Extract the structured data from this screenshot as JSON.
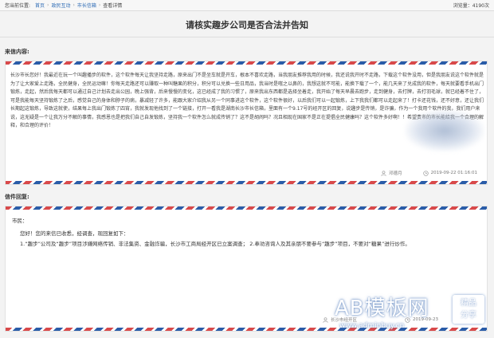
{
  "breadcrumb": {
    "label": "您当前位置:",
    "items": [
      "首页",
      "政民互动",
      "市长信箱"
    ],
    "current": "查看详情",
    "views": "浏览量：4190次"
  },
  "page_title": "请核实趣步公司是否合法并告知",
  "letter": {
    "section_label": "来信内容:",
    "body": "长沙市长您好！我最近在玩一个叫趣播步的软件，这个软件每天让我坚持走路，原来出门不是坐车就是开车，根本不喜欢走路，当我朋友推荐我用的时候，我还说我开时不走路，下载这个软件没用，但是我朋友说这个软件就是为了让大家爱上走路，全民健身，全民运动嘛！你每天走路还可以赚取一种叫糖果的积分，积分可以兑换一些日用品，我当时是嗤之以鼻的，我想这就不可能，能换下载了一个，能几天来了兑成我的软件，每天就要看手机出门锻炼，走起，然后我每天都可以通过自己计划去走出公园，晚上强背，后来慢慢的变化，这已经成了我的习惯了，原来我出东西都是选择坐着走，我开始了每天早晨去跑步，走到健身，去打牌，去打羽毛球，就已经着不住了，可是我能每天坚持锻炼了之后，感觉自己的身体和脖子的病，暴减轻了许多，能跟大家介绍我从另一个同事进这个软件，这个软件很好，以后我们可以一起锻炼，上下我我们都可以走起来了！打卡还花钱，还不好意，还让我们长期起这锻炼，导致这就使，结果每上我出门锻炼了四宵，我就发现他找到了一个链接，打开一看我是湖南长沙市长信箱，里面有一个9.17号的经开区的回复，说趣步是传销，是诈骗，作为一个我用个软件的我，我们用户来说，这无疑是一个让我万分不解的事情，我感恩也是把我们自己自发锻炼，坚持我一个软件怎么就成传销了？这不是胡闹吗？况且相现在国家不是正在提倡全民健康吗？这个软件多好啊！！希望贵市的市长能给我一个合理的解释，和合理的评价！",
    "author": "邓德月",
    "timestamp": "2019-09-22 01:16:01"
  },
  "reply": {
    "section_label": "信件回复:",
    "greeting": "市民：",
    "line1": "您好！您的来信已收悉，经调查，现回复如下：",
    "line2": "1.“趣步”公司及“趣步”项目涉嫌网络传销、非法集资、金融诈骗，长沙市工商局经开区已立案调查；  2.奉劝咨询人及其亲朋不要参与“趣步”项目，不要对“糖果”进行炒作。",
    "author": "长沙市经开区",
    "date": "2019-09-23"
  },
  "watermark": {
    "main": "AB模板网",
    "url": "www.adminbuy.cn",
    "badge_line1": "精品",
    "badge_line2": "分享"
  },
  "colors": {
    "airmail_red": "#d8494a",
    "airmail_blue": "#2a5ca8",
    "link_blue": "#2f6cb5"
  }
}
